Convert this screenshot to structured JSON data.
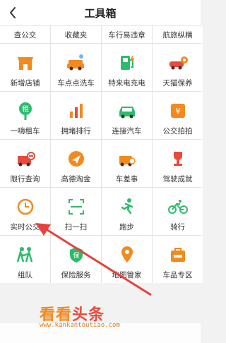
{
  "header": {
    "title": "工具箱",
    "back_icon": "chevron-left-icon"
  },
  "top_row": [
    {
      "label": "查公交"
    },
    {
      "label": "收藏夹"
    },
    {
      "label": "车行易违章"
    },
    {
      "label": "航旅纵横"
    }
  ],
  "items": [
    {
      "label": "新增店铺",
      "icon": "shop-icon",
      "color": "#f28a1e"
    },
    {
      "label": "车点点洗车",
      "icon": "car-wash-icon",
      "color": "#f28a1e"
    },
    {
      "label": "特来电充电",
      "icon": "charging-station-icon",
      "color": "#2dbb6c"
    },
    {
      "label": "天猫保养",
      "icon": "car-maintenance-icon",
      "color": "#e84b3c"
    },
    {
      "label": "一嗨租车",
      "icon": "car-rental-icon",
      "color": "#2dbb6c"
    },
    {
      "label": "拥堵排行",
      "icon": "bar-chart-icon",
      "color": "#f28a1e"
    },
    {
      "label": "连接汽车",
      "icon": "car-connect-icon",
      "color": "#2dbb6c"
    },
    {
      "label": "公交拍拍",
      "icon": "bus-photo-icon",
      "color": "#f28a1e"
    },
    {
      "label": "限行查询",
      "icon": "restriction-icon",
      "color": "#e84b3c"
    },
    {
      "label": "高德淘金",
      "icon": "navigation-icon",
      "color": "#f28a1e"
    },
    {
      "label": "车差事",
      "icon": "car-task-icon",
      "color": "#f28a1e"
    },
    {
      "label": "驾驶成就",
      "icon": "trophy-icon",
      "color": "#e84b3c"
    },
    {
      "label": "实时公交",
      "icon": "clock-icon",
      "color": "#f28a1e"
    },
    {
      "label": "扫一扫",
      "icon": "scan-icon",
      "color": "#2dbb6c"
    },
    {
      "label": "跑步",
      "icon": "running-icon",
      "color": "#2dbb6c"
    },
    {
      "label": "骑行",
      "icon": "bicycle-icon",
      "color": "#2dbb6c"
    },
    {
      "label": "组队",
      "icon": "team-icon",
      "color": "#2dbb6c"
    },
    {
      "label": "保险服务",
      "icon": "insurance-shield-icon",
      "color": "#2dbb6c"
    },
    {
      "label": "地图管家",
      "icon": "map-pin-icon",
      "color": "#f28a1e"
    },
    {
      "label": "车品专区",
      "icon": "car-goods-icon",
      "color": "#f28a1e"
    }
  ],
  "watermark": {
    "big": "看看头条",
    "small": "www.kankantoutiao.com"
  },
  "colors": {
    "orange": "#f28a1e",
    "green": "#2dbb6c",
    "red": "#e84b3c",
    "arrow": "#e8413a"
  }
}
